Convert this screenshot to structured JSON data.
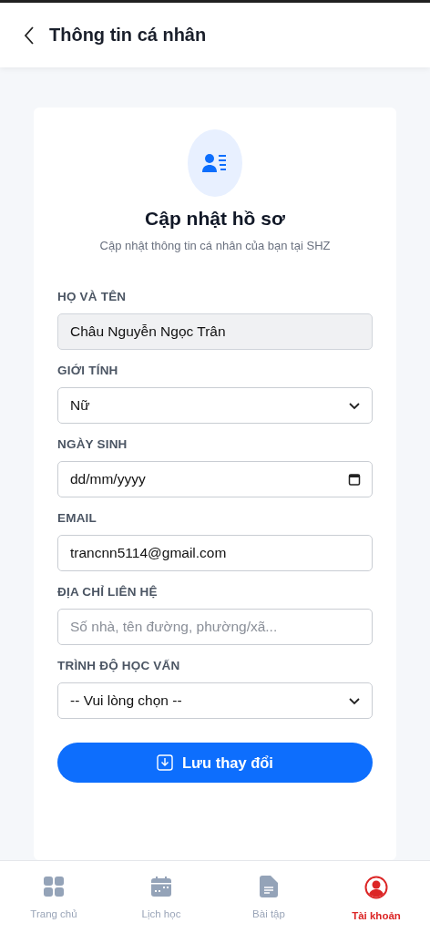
{
  "header": {
    "title": "Thông tin cá nhân"
  },
  "card": {
    "title": "Cập nhật hồ sơ",
    "subtitle": "Cập nhật thông tin cá nhân của bạn tại SHZ"
  },
  "fields": [
    {
      "label": "HỌ VÀ TÊN",
      "kind": "readonly",
      "value": "Châu Nguyễn Ngọc Trân"
    },
    {
      "label": "GIỚI TÍNH",
      "kind": "select",
      "value": "Nữ"
    },
    {
      "label": "NGÀY SINH",
      "kind": "date",
      "value": "dd/mm/yyyy"
    },
    {
      "label": "EMAIL",
      "kind": "text",
      "value": "trancnn5114@gmail.com"
    },
    {
      "label": "ĐỊA CHỈ LIÊN HỆ",
      "kind": "text",
      "placeholder": "Số nhà, tên đường, phường/xã..."
    },
    {
      "label": "TRÌNH ĐỘ HỌC VẤN",
      "kind": "select",
      "value": "-- Vui lòng chọn --"
    }
  ],
  "save_button": "Lưu thay đổi",
  "nav": [
    {
      "label": "Trang chủ",
      "kind": "home",
      "selected": false
    },
    {
      "label": "Lịch học",
      "kind": "calendar",
      "selected": false
    },
    {
      "label": "Bài tập",
      "kind": "document",
      "selected": false
    },
    {
      "label": "Tài khoản",
      "kind": "account",
      "selected": true
    }
  ]
}
